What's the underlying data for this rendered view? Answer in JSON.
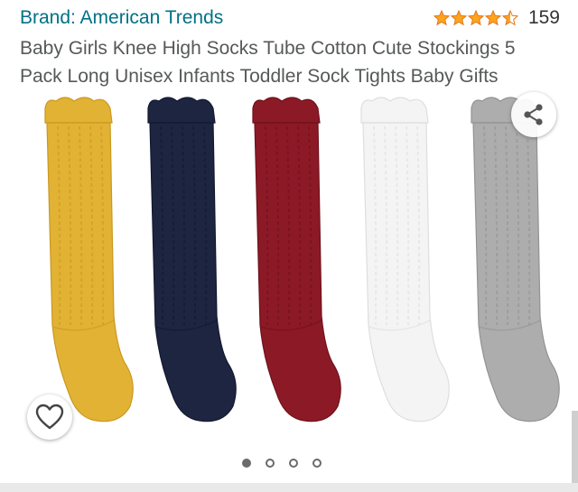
{
  "product": {
    "brand": "Brand: American Trends",
    "rating": {
      "stars": 4.5,
      "max": 5,
      "review_count": "159"
    },
    "title": "Baby Girls Knee High Socks Tube Cotton Cute Stockings 5 Pack Long Unisex Infants Toddler Sock Tights Baby Gifts"
  },
  "gallery": {
    "socks": [
      {
        "color": "#e2b234",
        "shade": "#c9981f"
      },
      {
        "color": "#1d2540",
        "shade": "#121830"
      },
      {
        "color": "#8c1a26",
        "shade": "#6d111b"
      },
      {
        "color": "#f4f4f4",
        "shade": "#dedede"
      },
      {
        "color": "#adadad",
        "shade": "#929292"
      }
    ],
    "image_count": 4,
    "active_image": 0
  },
  "actions": {
    "share_icon": "share-icon",
    "wishlist_icon": "heart-outline-icon"
  },
  "colors": {
    "brand_link": "#007185",
    "star": "#ffa41c",
    "title_text": "#565959"
  }
}
